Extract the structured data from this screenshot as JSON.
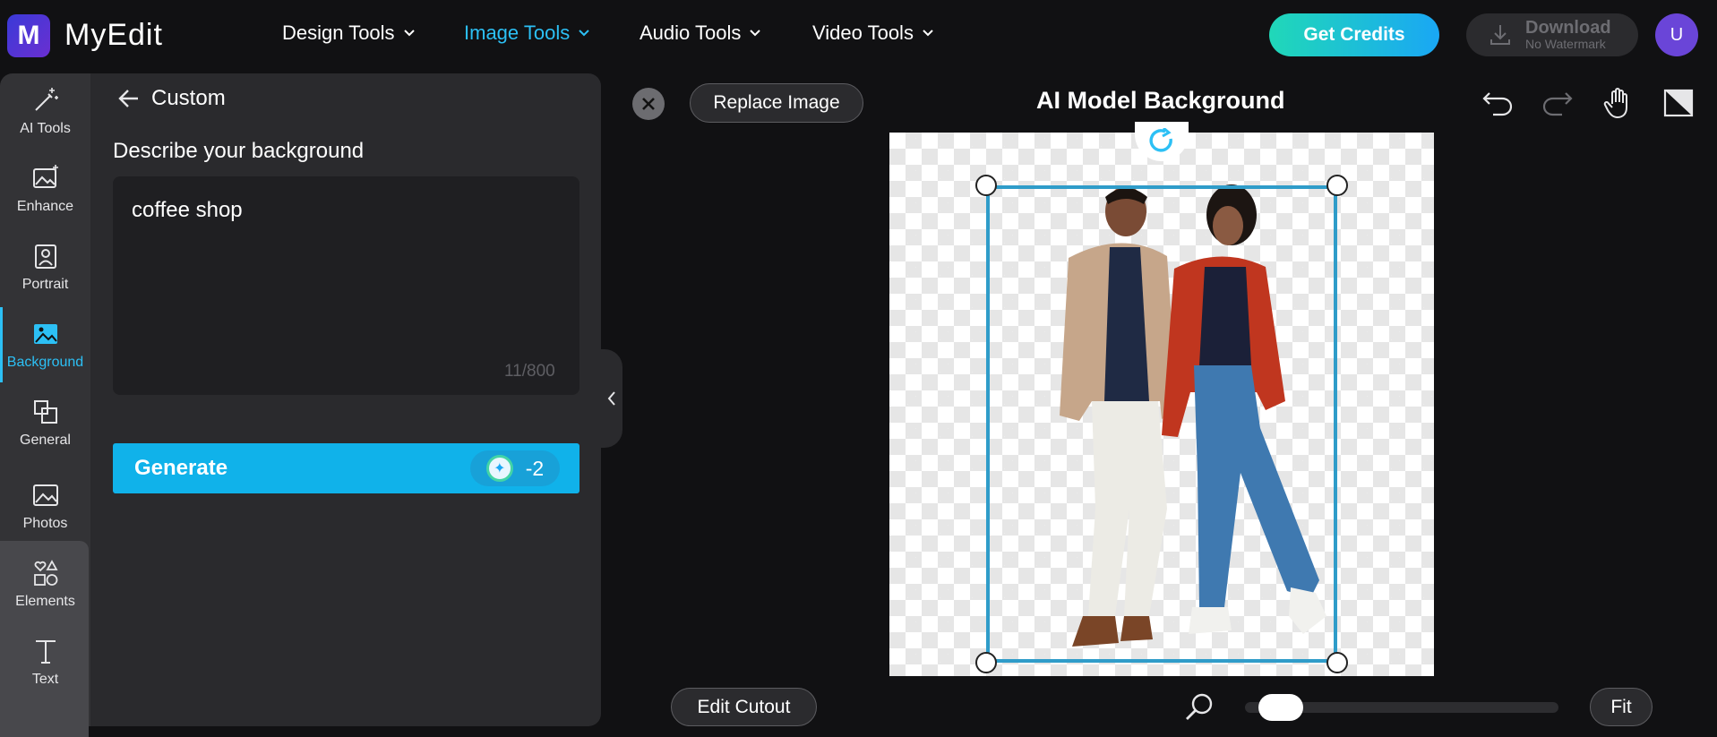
{
  "header": {
    "logo_letter": "M",
    "brand": "MyEdit",
    "nav": [
      {
        "label": "Design Tools",
        "active": false
      },
      {
        "label": "Image Tools",
        "active": true
      },
      {
        "label": "Audio Tools",
        "active": false
      },
      {
        "label": "Video Tools",
        "active": false
      }
    ],
    "credits_label": "Get Credits",
    "download_label": "Download",
    "download_sub": "No Watermark",
    "avatar_letter": "U"
  },
  "rail": {
    "items": [
      {
        "label": "AI Tools",
        "icon": "magic-wand-icon"
      },
      {
        "label": "Enhance",
        "icon": "image-sparkle-icon"
      },
      {
        "label": "Portrait",
        "icon": "portrait-icon"
      },
      {
        "label": "Background",
        "icon": "background-icon",
        "active": true
      },
      {
        "label": "General",
        "icon": "general-icon"
      },
      {
        "label": "Photos",
        "icon": "photos-icon"
      },
      {
        "label": "Elements",
        "icon": "elements-icon"
      },
      {
        "label": "Text",
        "icon": "text-icon"
      }
    ]
  },
  "panel": {
    "title": "Custom",
    "describe_label": "Describe your background",
    "prompt_value": "coffee shop",
    "counter": "11/800",
    "generate_label": "Generate",
    "generate_cost": "-2"
  },
  "canvas": {
    "replace_label": "Replace Image",
    "title": "AI Model Background",
    "edit_cutout_label": "Edit Cutout",
    "fit_label": "Fit",
    "zoom_level": 0.05
  },
  "colors": {
    "accent": "#10b2ea",
    "selection": "#2f9cc9",
    "background": "#111113",
    "panel": "#2a2a2d"
  }
}
